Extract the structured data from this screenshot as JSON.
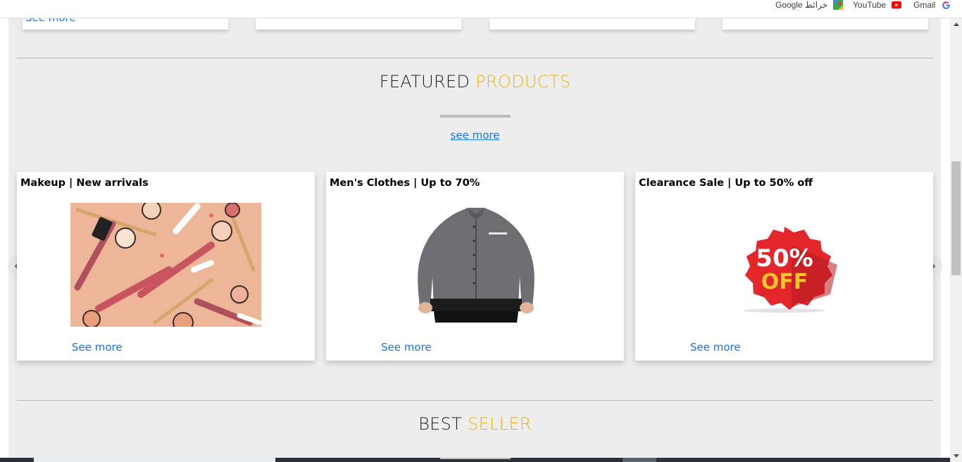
{
  "bookmarks": [
    {
      "label": "Gmail",
      "icon": "google-icon"
    },
    {
      "label": "YouTube",
      "icon": "youtube-icon"
    },
    {
      "label": "خرائط Google",
      "icon": "google-maps-icon"
    }
  ],
  "top_cards": [
    {
      "link": "See more"
    },
    {
      "link": ""
    },
    {
      "link": ""
    },
    {
      "link": ""
    }
  ],
  "featured": {
    "title_prefix": "FEATURED",
    "title_accent": "PRODUCTS",
    "see_more": "see more"
  },
  "cards": [
    {
      "title": "Makeup | New arrivals",
      "image": "makeup-image",
      "link": "See more"
    },
    {
      "title": "Men's Clothes | Up to 70%",
      "image": "shirt-image",
      "link": "See more"
    },
    {
      "title": "Clearance Sale | Up to 50% off",
      "image": "sale-badge-image",
      "link": "See more",
      "badge_line1": "50%",
      "badge_line2": "OFF"
    }
  ],
  "best_seller": {
    "title_prefix": "BEST",
    "title_accent": "SELLER"
  },
  "colors": {
    "accent": "#f4b400",
    "link": "#1a73e8",
    "background": "#ededed"
  }
}
